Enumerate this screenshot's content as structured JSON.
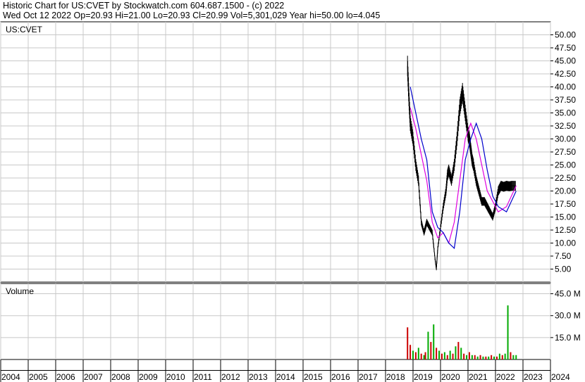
{
  "header": {
    "line1": "Historic Chart for US:CVET by Stockwatch.com 604.687.1500 - (c) 2022",
    "line2": "Wed Oct 12 2022   Op=20.93   Hi=21.00   Lo=20.93   Cl=20.99   Vol=5,301,029   Year hi=50.00   lo=4.045"
  },
  "colors": {
    "candle": "#000000",
    "ma_short": "#e000e0",
    "ma_long": "#0000cc",
    "vol_up": "#00aa00",
    "vol_down": "#cc0000",
    "grid": "#c8c8c8"
  },
  "chart_data": [
    {
      "type": "line",
      "panel": "price",
      "label": "US:CVET",
      "ylim": [
        2.5,
        52.5
      ],
      "y_ticks": [
        "50.00",
        "47.50",
        "45.00",
        "42.50",
        "40.00",
        "37.50",
        "35.00",
        "32.50",
        "30.00",
        "27.50",
        "25.00",
        "22.50",
        "20.00",
        "17.50",
        "15.00",
        "12.50",
        "10.00",
        "7.50",
        "5.00"
      ],
      "x_range": [
        2004,
        2024
      ],
      "series": [
        {
          "x": [
            2018.8,
            2018.85,
            2018.9,
            2019.0,
            2019.1,
            2019.2,
            2019.3,
            2019.4,
            2019.45,
            2019.5,
            2019.6,
            2019.7,
            2019.8,
            2019.85,
            2019.9,
            2020.0,
            2020.1,
            2020.2,
            2020.25,
            2020.3,
            2020.4,
            2020.5,
            2020.6,
            2020.7,
            2020.8,
            2020.9,
            2021.0,
            2021.05,
            2021.1,
            2021.15,
            2021.2,
            2021.3,
            2021.4,
            2021.5,
            2021.6,
            2021.7,
            2021.8,
            2021.9,
            2022.0,
            2022.1,
            2022.2,
            2022.3,
            2022.4,
            2022.5,
            2022.6,
            2022.75
          ],
          "values": [
            44,
            38,
            33,
            30,
            25,
            22,
            14,
            12,
            13,
            14,
            13,
            12,
            7,
            5,
            9,
            13,
            17,
            20,
            23,
            24,
            22,
            25,
            30,
            36,
            39,
            35,
            31,
            30,
            28,
            26,
            25,
            22,
            20,
            18,
            18,
            17,
            16,
            15,
            17,
            20,
            21,
            20.8,
            21,
            20.9,
            21,
            20.99
          ]
        },
        {
          "x": [
            2018.9,
            2019.1,
            2019.3,
            2019.5,
            2019.7,
            2019.9,
            2020.1,
            2020.3,
            2020.5,
            2020.7,
            2020.9,
            2021.1,
            2021.3,
            2021.5,
            2021.7,
            2021.9,
            2022.1,
            2022.4,
            2022.75
          ],
          "values": [
            36,
            32,
            27,
            22,
            14,
            11,
            12,
            10,
            14,
            22,
            30,
            33,
            30,
            25,
            20,
            18,
            16,
            17,
            21
          ]
        },
        {
          "x": [
            2018.9,
            2019.1,
            2019.3,
            2019.5,
            2019.7,
            2019.9,
            2020.1,
            2020.3,
            2020.5,
            2020.7,
            2020.9,
            2021.1,
            2021.3,
            2021.5,
            2021.7,
            2021.9,
            2022.1,
            2022.4,
            2022.75
          ],
          "values": [
            40,
            35,
            30,
            26,
            16,
            13,
            12,
            10,
            9,
            16,
            26,
            30,
            33,
            30,
            24,
            19,
            17,
            16,
            20
          ]
        }
      ]
    },
    {
      "type": "bar",
      "panel": "volume",
      "title": "Volume",
      "ylim": [
        0,
        52
      ],
      "y_ticks": [
        "45.0 M",
        "30.0 M",
        "15.0 M"
      ],
      "x": [
        2018.8,
        2018.9,
        2019.0,
        2019.1,
        2019.2,
        2019.3,
        2019.4,
        2019.45,
        2019.55,
        2019.65,
        2019.75,
        2019.85,
        2019.95,
        2020.05,
        2020.15,
        2020.25,
        2020.35,
        2020.45,
        2020.55,
        2020.65,
        2020.75,
        2020.85,
        2020.95,
        2021.05,
        2021.15,
        2021.25,
        2021.35,
        2021.45,
        2021.55,
        2021.65,
        2021.75,
        2021.85,
        2021.95,
        2022.05,
        2022.15,
        2022.25,
        2022.35,
        2022.45,
        2022.55,
        2022.65,
        2022.75
      ],
      "values": [
        22,
        10,
        6,
        5,
        8,
        4,
        3,
        5,
        19,
        12,
        24,
        8,
        6,
        4,
        5,
        3,
        6,
        4,
        9,
        12,
        8,
        4,
        3,
        5,
        3,
        3,
        2,
        3,
        2,
        2,
        2,
        3,
        2,
        2,
        4,
        3,
        4,
        37,
        5,
        3,
        3
      ],
      "colors": [
        "down",
        "down",
        "up",
        "down",
        "up",
        "down",
        "up",
        "down",
        "up",
        "down",
        "up",
        "down",
        "up",
        "down",
        "up",
        "down",
        "up",
        "down",
        "up",
        "down",
        "up",
        "down",
        "up",
        "down",
        "up",
        "down",
        "up",
        "down",
        "up",
        "down",
        "up",
        "down",
        "up",
        "down",
        "up",
        "down",
        "up",
        "up",
        "down",
        "up",
        "up"
      ]
    }
  ],
  "x_axis": {
    "labels": [
      "2004",
      "2005",
      "2006",
      "2007",
      "2008",
      "2009",
      "2010",
      "2011",
      "2012",
      "2013",
      "2014",
      "2015",
      "2016",
      "2017",
      "2018",
      "2019",
      "2020",
      "2021",
      "2022",
      "2023",
      "2024"
    ]
  }
}
